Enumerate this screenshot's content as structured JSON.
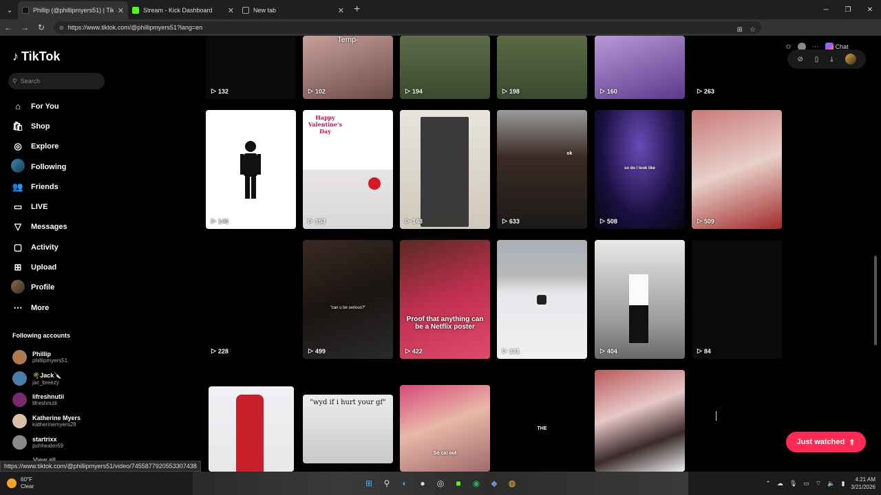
{
  "browser": {
    "tabs": [
      {
        "label": "Phillip (@phillipmyers51) | TikTok",
        "active": true,
        "fav_color": "#000000"
      },
      {
        "label": "Stream - Kick Dashboard",
        "active": false,
        "fav_color": "#53fc18"
      },
      {
        "label": "New tab",
        "active": false,
        "fav_color": "#555555"
      }
    ],
    "url": "https://www.tiktok.com/@phillipmyers51?lang=en",
    "chat_label": "Chat"
  },
  "sidebar": {
    "logo": "TikTok",
    "search_placeholder": "Search",
    "menu": [
      {
        "label": "For You",
        "icon": "home-icon"
      },
      {
        "label": "Shop",
        "icon": "shop-icon"
      },
      {
        "label": "Explore",
        "icon": "compass-icon"
      },
      {
        "label": "Following",
        "icon": "avatar-icon"
      },
      {
        "label": "Friends",
        "icon": "friends-icon"
      },
      {
        "label": "LIVE",
        "icon": "live-icon"
      },
      {
        "label": "Messages",
        "icon": "messages-icon"
      },
      {
        "label": "Activity",
        "icon": "activity-icon"
      },
      {
        "label": "Upload",
        "icon": "upload-icon"
      },
      {
        "label": "Profile",
        "icon": "profile-avatar-icon"
      },
      {
        "label": "More",
        "icon": "more-icon"
      }
    ],
    "following_title": "Following accounts",
    "accounts": [
      {
        "name": "Phillip",
        "handle": "phillipmyers51",
        "color": "#b07a4f"
      },
      {
        "name": "🌴Jack🔪",
        "handle": "jac_breezy",
        "color": "#4a7da8"
      },
      {
        "name": "lifreshnutii",
        "handle": "lifreshnutii",
        "color": "#7a2a6a"
      },
      {
        "name": "Katherine Myers",
        "handle": "katherinemyers28",
        "color": "#d8c0a8"
      },
      {
        "name": "startrixx",
        "handle": "puhheater69",
        "color": "#8a8a8a"
      }
    ],
    "view_all": "View all"
  },
  "grid": {
    "tiles": [
      {
        "count": "132",
        "caption": ""
      },
      {
        "count": "102",
        "caption": "Temp-"
      },
      {
        "count": "194",
        "caption": ""
      },
      {
        "count": "198",
        "caption": ""
      },
      {
        "count": "160",
        "caption": ""
      },
      {
        "count": "263",
        "caption": ""
      },
      {
        "count": "146",
        "caption": ""
      },
      {
        "count": "153",
        "caption": "Happy Valentine's Day"
      },
      {
        "count": "148",
        "caption": ""
      },
      {
        "count": "633",
        "caption": "ok"
      },
      {
        "count": "508",
        "caption": "so do I look like"
      },
      {
        "count": "509",
        "caption": ""
      },
      {
        "count": "228",
        "caption": ""
      },
      {
        "count": "499",
        "caption": "\"can u be serious?\""
      },
      {
        "count": "422",
        "caption": "Proof that anything can be a Netflix poster"
      },
      {
        "count": "131",
        "caption": ""
      },
      {
        "count": "404",
        "caption": ""
      },
      {
        "count": "84",
        "caption": ""
      },
      {
        "count": "",
        "caption": ""
      },
      {
        "count": "",
        "caption": "\"wyd if i hurt your gf\""
      },
      {
        "count": "",
        "caption": "So cal out"
      },
      {
        "count": "",
        "caption": "THE"
      },
      {
        "count": "",
        "caption": ""
      }
    ]
  },
  "just_watched": "Just watched",
  "status_url": "https://www.tiktok.com/@phillipmyers51/video/7455877920553307438",
  "taskbar": {
    "weather_temp": "60°F",
    "weather_desc": "Clear",
    "time": "4:21 AM",
    "date": "3/21/2026"
  }
}
